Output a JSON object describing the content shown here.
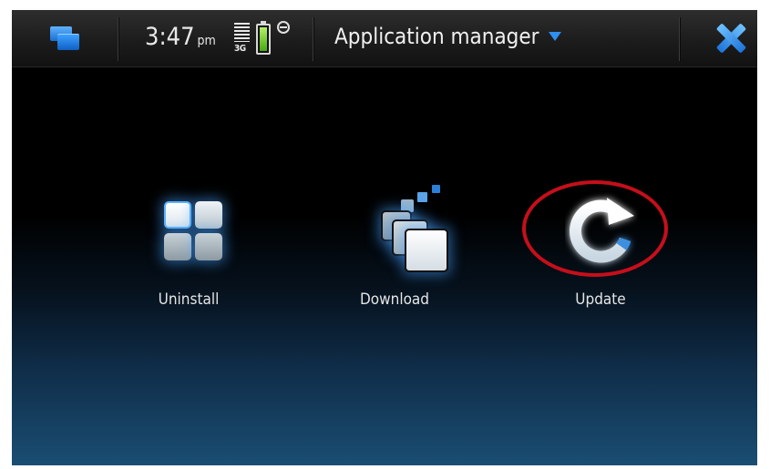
{
  "status_bar": {
    "time": "3:47",
    "ampm": "pm",
    "network_type": "3G",
    "battery_icon": "battery-full-icon",
    "status_icon": "presence-status-icon"
  },
  "header": {
    "title": "Application manager",
    "menu_icon": "dropdown-caret-icon",
    "task_switcher_icon": "task-switcher-icon",
    "close_icon": "close-icon"
  },
  "actions": [
    {
      "label": "Uninstall",
      "icon": "uninstall-grid-icon"
    },
    {
      "label": "Download",
      "icon": "download-squares-icon"
    },
    {
      "label": "Update",
      "icon": "refresh-arrow-icon"
    }
  ],
  "annotation": {
    "highlight_color": "#c50f1b"
  },
  "colors": {
    "accent": "#2f8ff0",
    "battery_green": "#7ad32a"
  }
}
